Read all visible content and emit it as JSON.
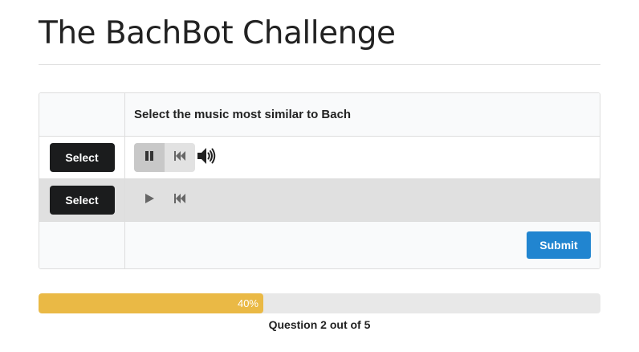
{
  "page": {
    "title": "The BachBot Challenge"
  },
  "question": {
    "prompt": "Select the music most similar to Bach",
    "options": [
      {
        "select_label": "Select",
        "player_state": "playing",
        "controls": [
          "pause-icon",
          "rewind-icon",
          "volume-icon"
        ]
      },
      {
        "select_label": "Select",
        "player_state": "stopped",
        "controls": [
          "play-icon",
          "rewind-icon"
        ]
      }
    ],
    "submit_label": "Submit"
  },
  "progress": {
    "fraction": 0.4,
    "percent_label": "40%",
    "status": "Question 2 out of 5"
  },
  "colors": {
    "select_button": "#1b1c1d",
    "submit_button": "#2185d0",
    "progress_fill": "#eab945",
    "progress_track": "#e8e8e8"
  }
}
